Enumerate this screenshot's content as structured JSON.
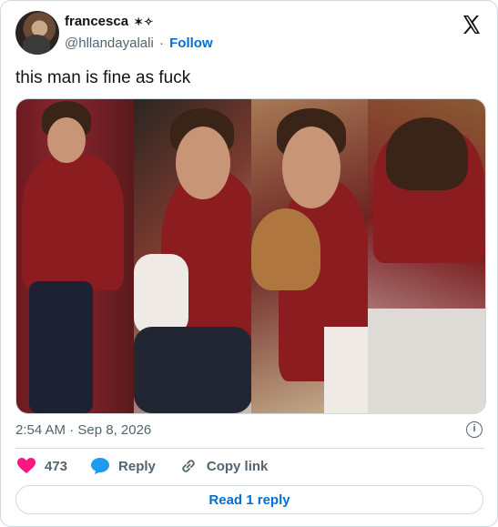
{
  "author": {
    "name": "francesca",
    "name_emoji": "✶✧",
    "handle": "@hllandayalali",
    "follow_label": "Follow"
  },
  "tweet": {
    "text": "this man is fine as fuck"
  },
  "media": {
    "photos": [
      "photo-1",
      "photo-2",
      "photo-3",
      "photo-4"
    ]
  },
  "meta": {
    "timestamp": "2:54 AM · Sep 8, 2026",
    "info_icon": "info-icon"
  },
  "actions": {
    "likes": "473",
    "reply_label": "Reply",
    "copy_link_label": "Copy link"
  },
  "footer": {
    "read_replies_label": "Read 1 reply"
  },
  "colors": {
    "accent": "#006fd6",
    "like": "#f91880",
    "reply_icon": "#1d9bf0",
    "text_secondary": "#536471",
    "border": "#cfd9de"
  }
}
